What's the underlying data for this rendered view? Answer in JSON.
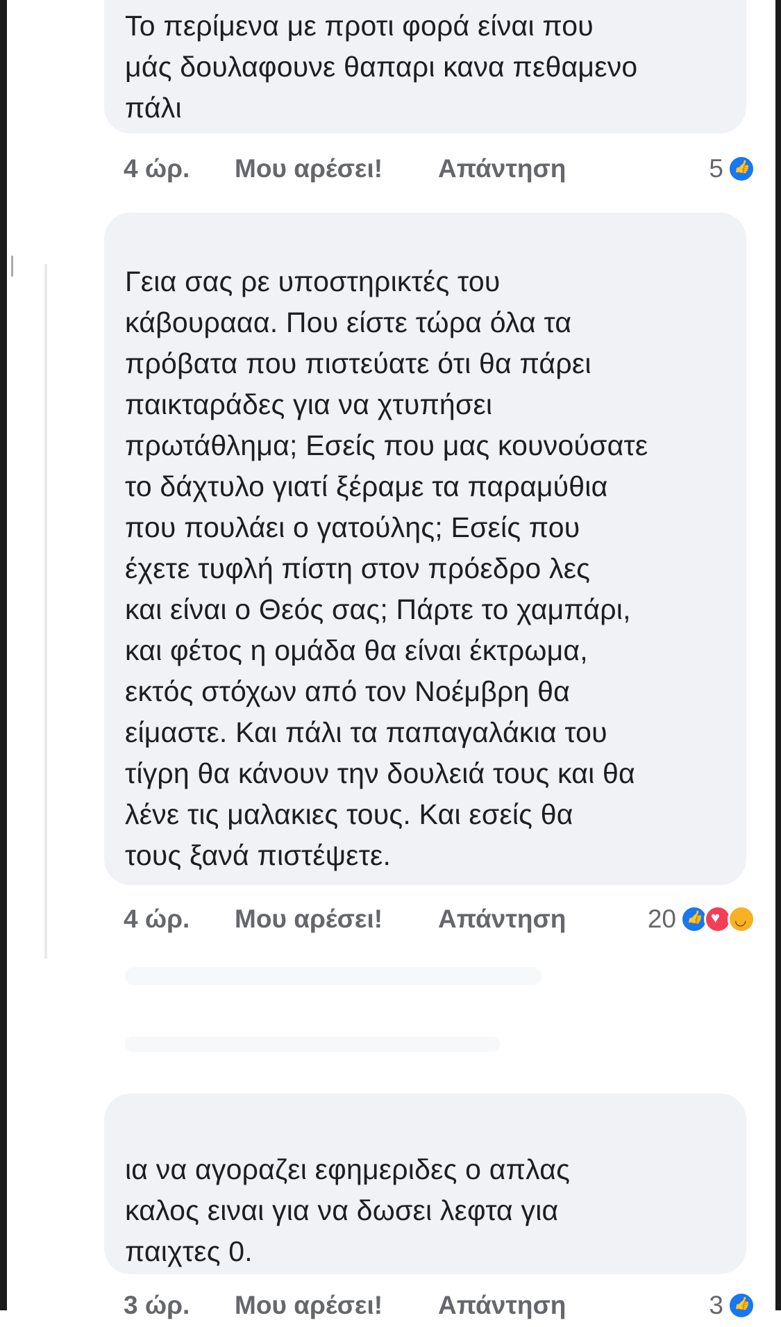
{
  "comments": [
    {
      "text": "Το περίμενα με προτι φορά είναι που\nμάς δουλαφουνε θαπαρι κανα πεθαμενο\nπάλι",
      "time": "4 ώρ.",
      "like_label": "Μου αρέσει!",
      "reply_label": "Απάντηση",
      "reaction_count": "5",
      "reactions": [
        "like-icon"
      ]
    },
    {
      "text": "Γεια σας ρε υποστηρικτές του\nκάβουρααα. Που είστε τώρα όλα τα\nπρόβατα που πιστεύατε ότι θα πάρει\nπαικταράδες για να χτυπήσει\nπρωτάθλημα; Εσείς που μας κουνούσατε\nτο δάχτυλο γιατί ξέραμε τα παραμύθια\nπου πουλάει ο γατούλης; Εσείς που\nέχετε τυφλή πίστη στον πρόεδρο λες\nκαι είναι ο Θεός σας; Πάρτε το χαμπάρι,\nκαι φέτος η ομάδα θα είναι έκτρωμα,\nεκτός στόχων από τον Νοέμβρη θα\nείμαστε. Και πάλι τα παπαγαλάκια του\nτίγρη θα κάνουν την δουλειά τους και θα\nλένε τις μαλακιες τους. Και εσείς θα\nτους ξανά πιστέψετε.",
      "time": "4 ώρ.",
      "like_label": "Μου αρέσει!",
      "reply_label": "Απάντηση",
      "reaction_count": "20",
      "reactions": [
        "like-icon",
        "love-icon",
        "haha-icon"
      ]
    },
    {
      "text": "ια να αγοραζει εφημεριδες ο απλας\nκαλος ειναι για να δωσει λεφτα για\nπαιχτες 0.",
      "time": "3 ώρ.",
      "like_label": "Μου αρέσει!",
      "reply_label": "Απάντηση",
      "reaction_count": "3",
      "reactions": [
        "like-icon"
      ]
    }
  ],
  "colors": {
    "bubble_bg": "#f0f2f5",
    "text": "#1c1e21",
    "meta_text": "#65676b",
    "like_blue": "#1877f2",
    "love_red": "#f33e58",
    "haha_yellow": "#f7b125"
  }
}
